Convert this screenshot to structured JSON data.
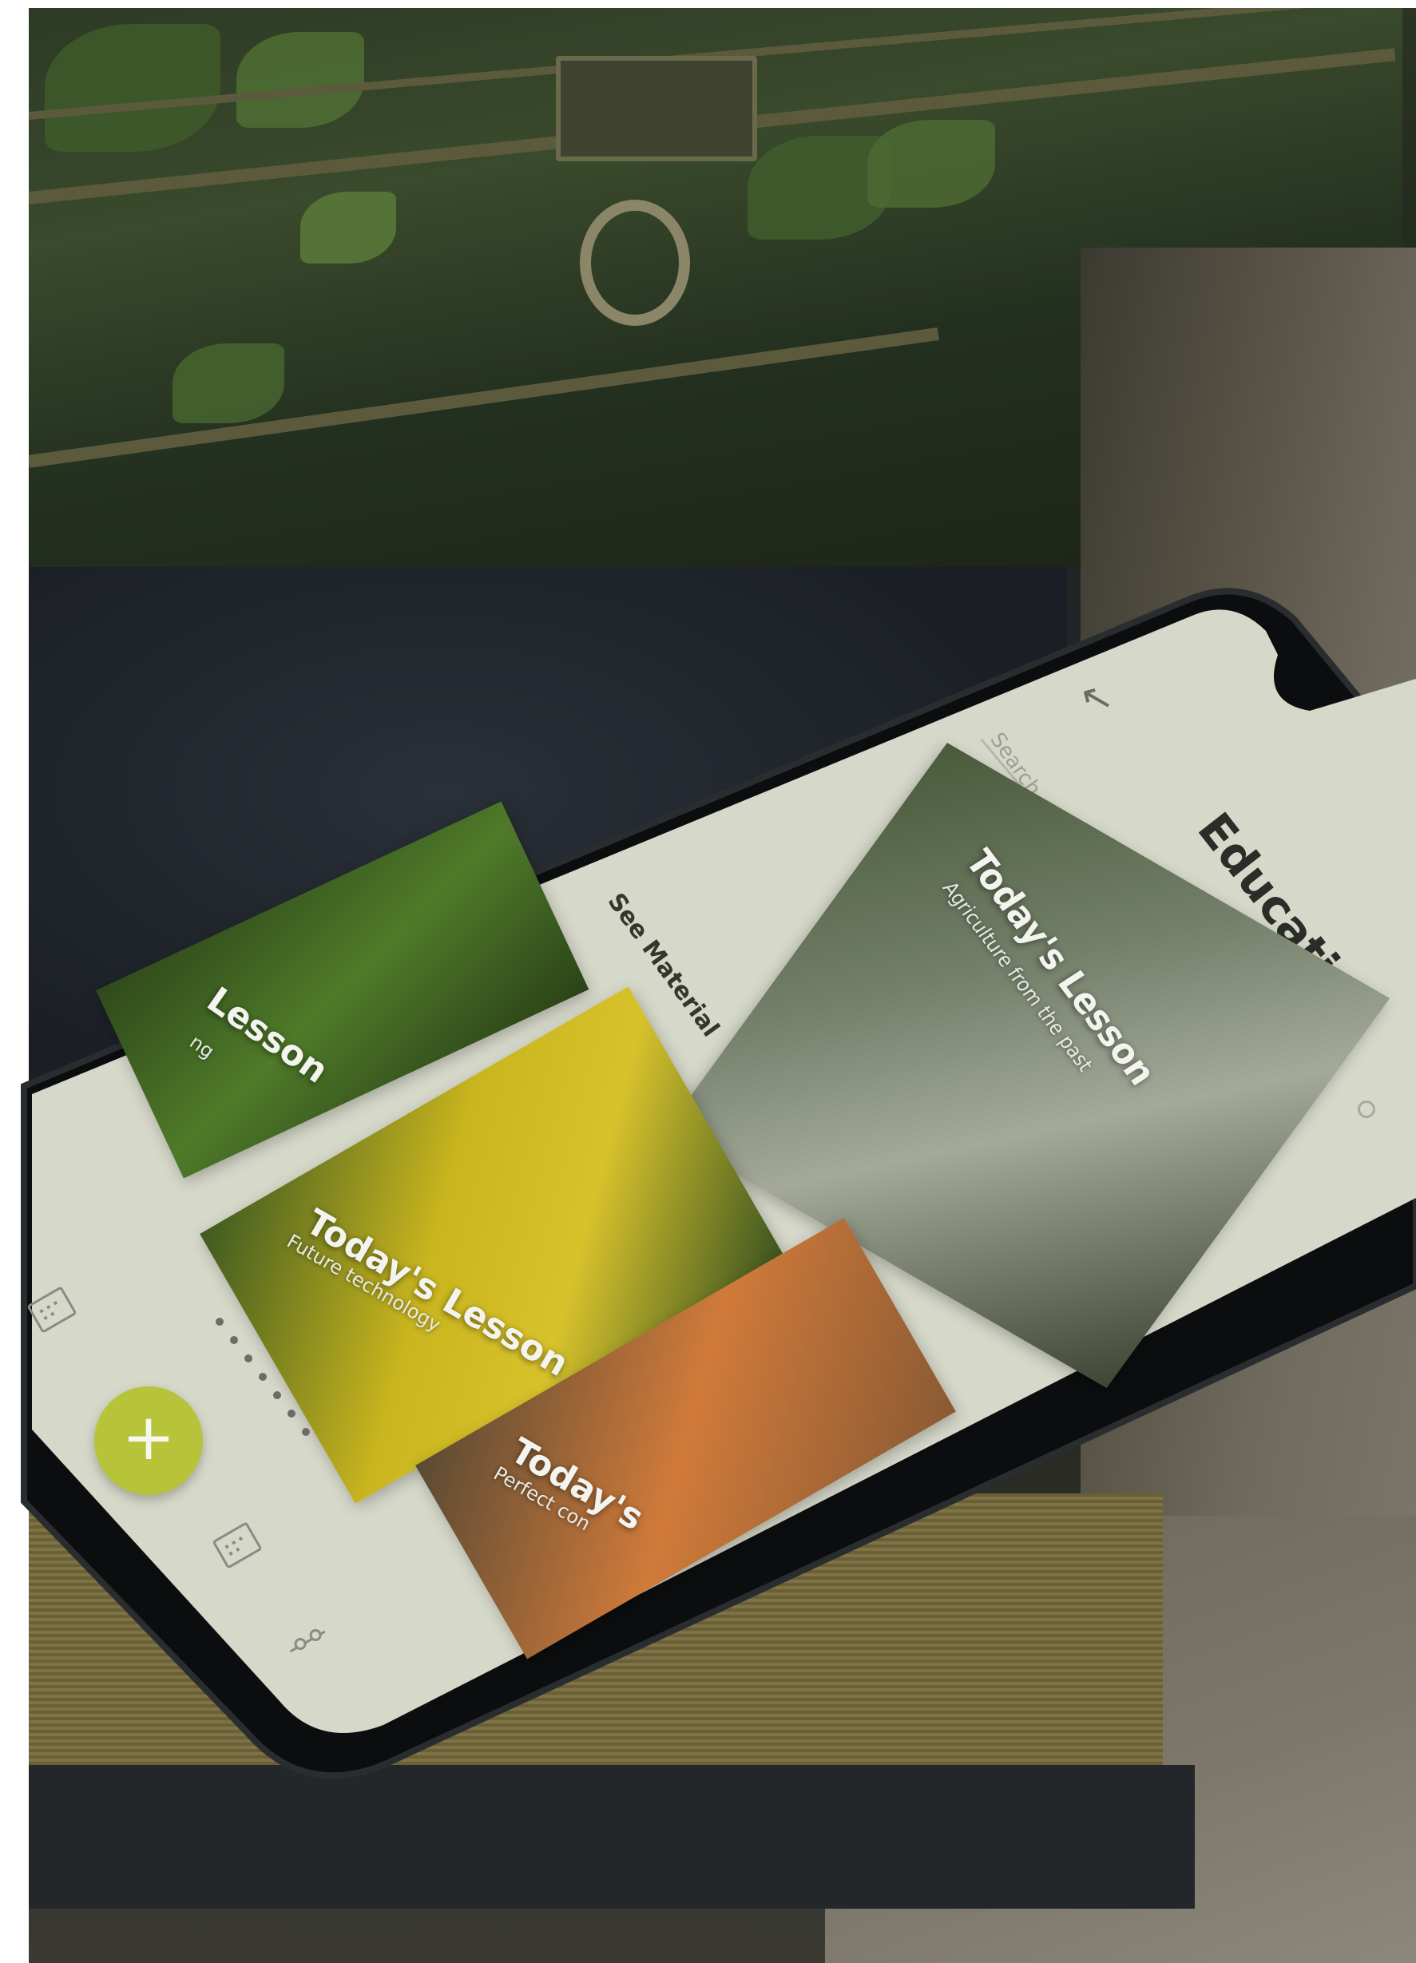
{
  "app": {
    "title": "Education",
    "search": {
      "placeholder": "Search"
    },
    "see_material_label": "See Material"
  },
  "lessons": [
    {
      "title": "Today's Lesson",
      "subtitle": "Agriculture from the past"
    },
    {
      "title": "Today's Lesson",
      "subtitle": "Future technology"
    },
    {
      "title": "Today's",
      "subtitle": "Perfect con"
    },
    {
      "title": "Lesson",
      "subtitle": "ng"
    }
  ],
  "fab": {
    "label": "+"
  },
  "icons": {
    "back": "arrow-left-icon",
    "search": "search-icon",
    "home": "calendar-grid-icon",
    "schedule": "calendar-icon",
    "settings": "sliders-icon"
  },
  "colors": {
    "accent": "#b7c43a",
    "screen_bg": "#d8dbcc",
    "text": "#2e302b"
  },
  "pager": {
    "count": 7,
    "active_index": 0
  }
}
